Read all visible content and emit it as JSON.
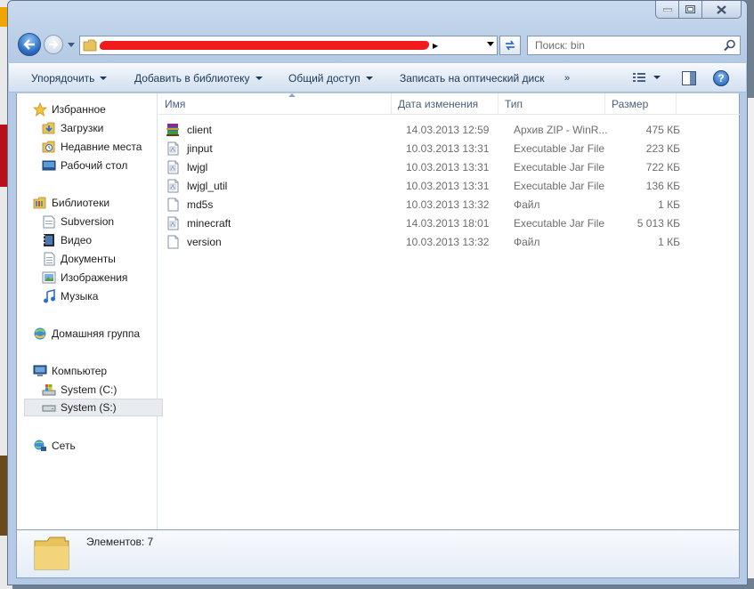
{
  "window": {
    "current_folder": "bin",
    "caption": {
      "minimize": "minimize",
      "maximize": "maximize",
      "close": "close"
    }
  },
  "search": {
    "placeholder": "Поиск: bin"
  },
  "toolbar": {
    "organize": "Упорядочить",
    "add_to_library": "Добавить в библиотеку",
    "share": "Общий доступ",
    "burn": "Записать на оптический диск",
    "more": "»"
  },
  "navigation": {
    "favorites": {
      "label": "Избранное",
      "items": [
        "Загрузки",
        "Недавние места",
        "Рабочий стол"
      ]
    },
    "libraries": {
      "label": "Библиотеки",
      "items": [
        "Subversion",
        "Видео",
        "Документы",
        "Изображения",
        "Музыка"
      ]
    },
    "homegroup": {
      "label": "Домашняя группа"
    },
    "computer": {
      "label": "Компьютер",
      "items": [
        "System (C:)",
        "System (S:)"
      ]
    },
    "network": {
      "label": "Сеть"
    }
  },
  "columns": {
    "name": "Имя",
    "date": "Дата изменения",
    "type": "Тип",
    "size": "Размер"
  },
  "files": [
    {
      "name": "client",
      "date": "14.03.2013 12:59",
      "type": "Архив ZIP - WinR...",
      "size": "475 КБ",
      "icon": "winrar-archive-icon"
    },
    {
      "name": "jinput",
      "date": "10.03.2013 13:31",
      "type": "Executable Jar File",
      "size": "223 КБ",
      "icon": "jar-file-icon"
    },
    {
      "name": "lwjgl",
      "date": "10.03.2013 13:31",
      "type": "Executable Jar File",
      "size": "722 КБ",
      "icon": "jar-file-icon"
    },
    {
      "name": "lwjgl_util",
      "date": "10.03.2013 13:31",
      "type": "Executable Jar File",
      "size": "136 КБ",
      "icon": "jar-file-icon"
    },
    {
      "name": "md5s",
      "date": "10.03.2013 13:32",
      "type": "Файл",
      "size": "1 КБ",
      "icon": "blank-file-icon"
    },
    {
      "name": "minecraft",
      "date": "14.03.2013 18:01",
      "type": "Executable Jar File",
      "size": "5 013 КБ",
      "icon": "jar-file-icon"
    },
    {
      "name": "version",
      "date": "10.03.2013 13:32",
      "type": "Файл",
      "size": "1 КБ",
      "icon": "blank-file-icon"
    }
  ],
  "status": {
    "item_count": "Элементов: 7"
  }
}
